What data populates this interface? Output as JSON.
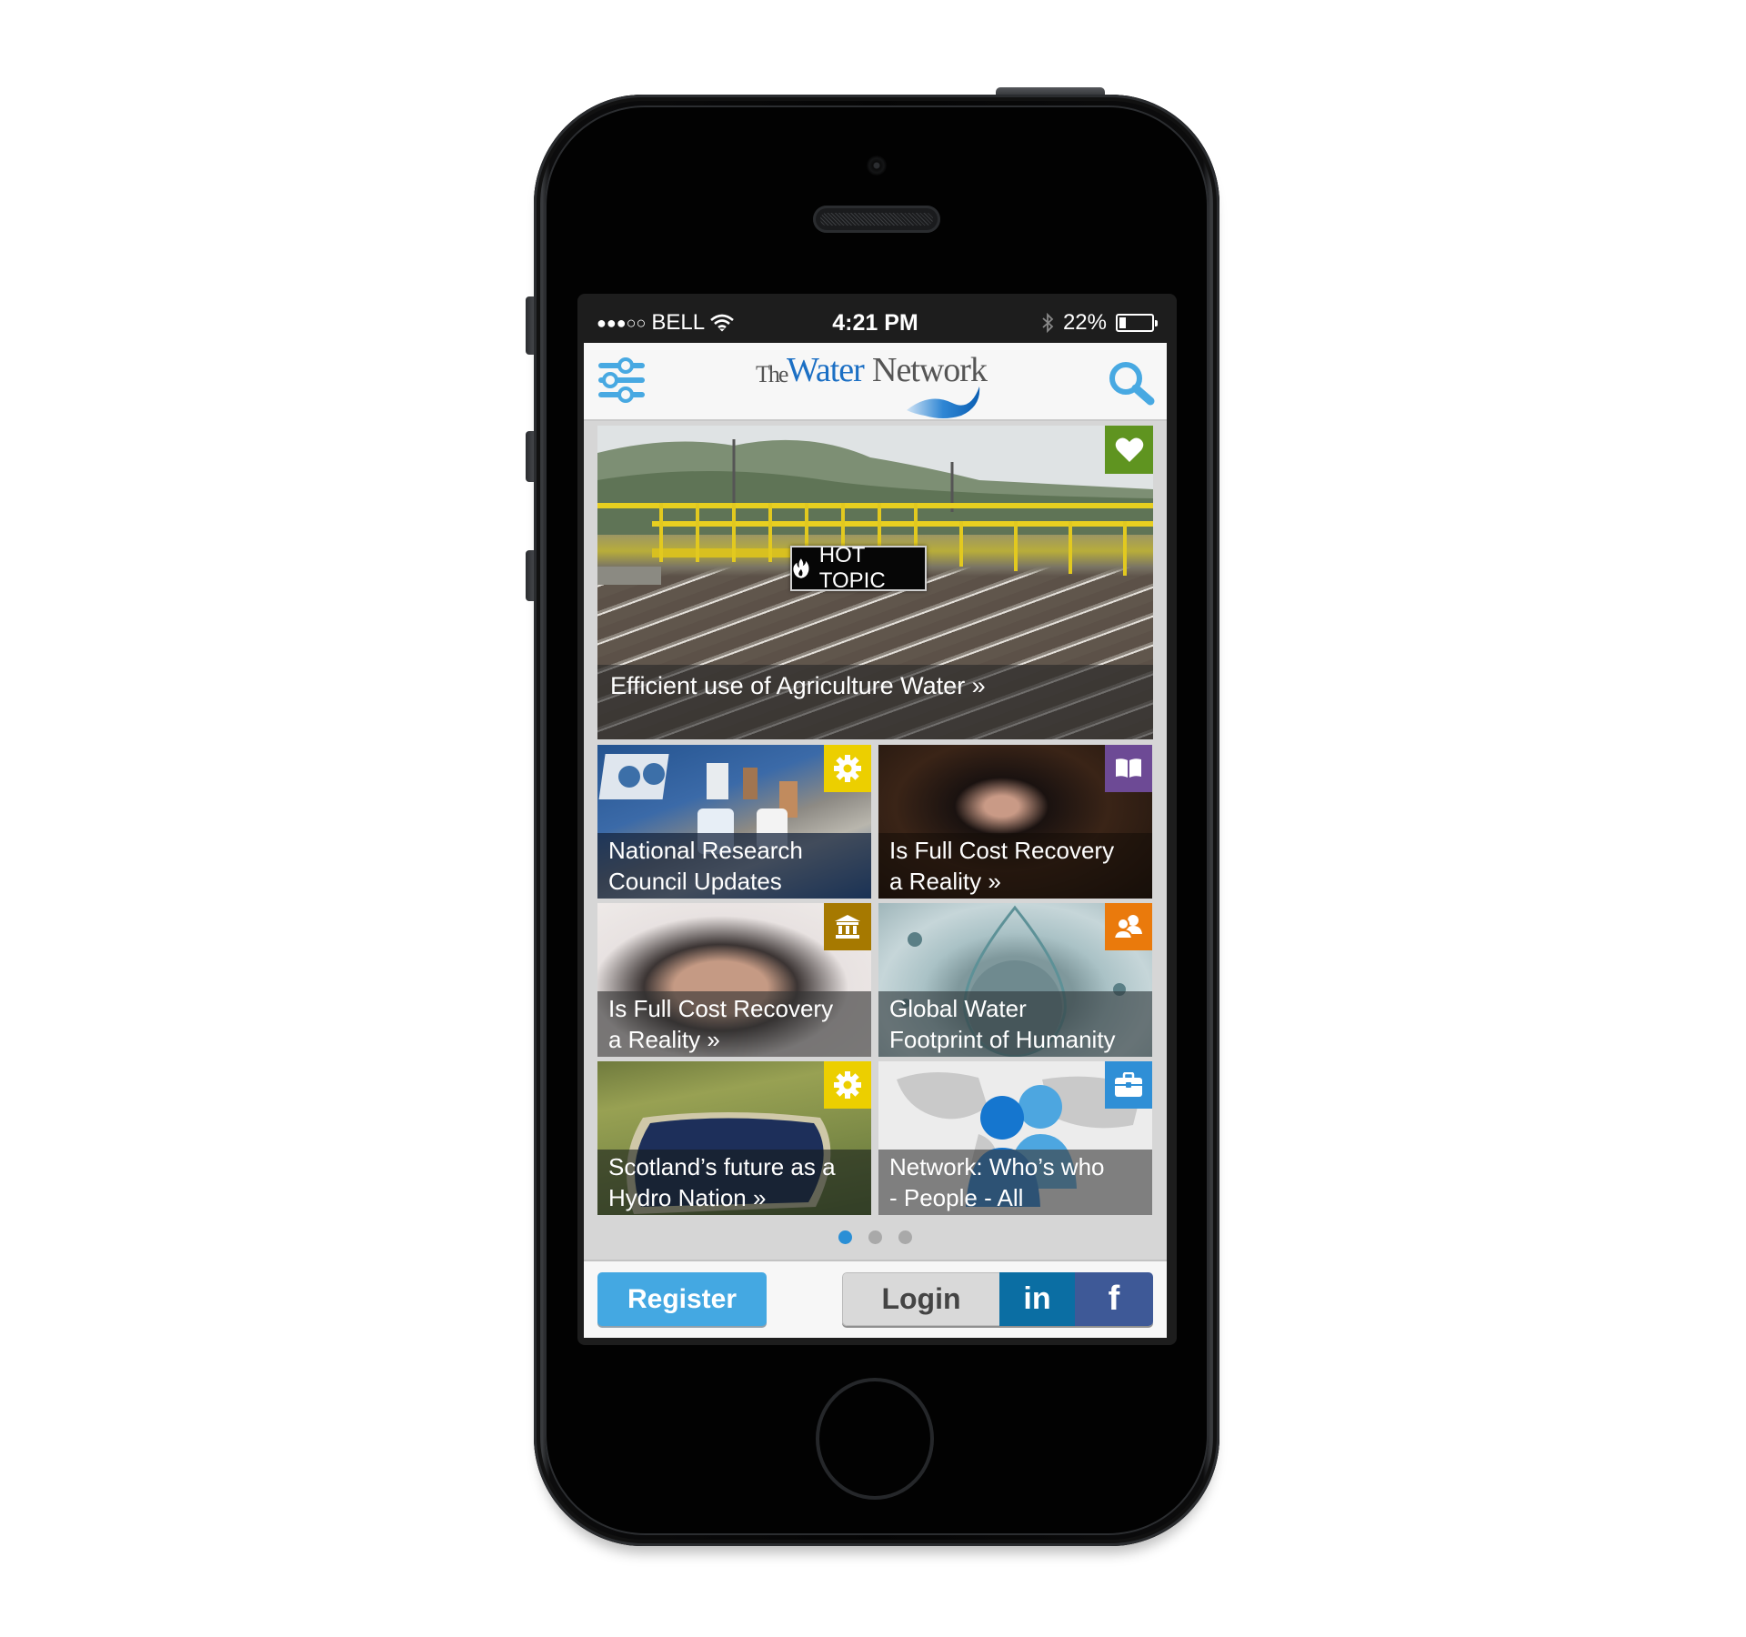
{
  "status_bar": {
    "signal_dots": "●●●○○",
    "carrier": "BELL",
    "time": "4:21 PM",
    "battery_percent_label": "22%",
    "battery_level": 0.22
  },
  "header": {
    "logo_the": "The",
    "logo_water": "Water",
    "logo_network": "Network",
    "menu_icon": "sliders-icon",
    "search_icon": "search-icon"
  },
  "hero": {
    "badge_label": "HOT TOPIC",
    "badge_icon": "flame-icon",
    "caption": "Efficient use of Agriculture Water »",
    "category_icon": "heart-icon",
    "category_color": "#5f9420"
  },
  "tiles": [
    {
      "line1": "National Research",
      "line2": "Council Updates",
      "category_icon": "gear-icon",
      "category_color": "#eccf00"
    },
    {
      "line1": "Is Full Cost Recovery",
      "line2": "a Reality »",
      "category_icon": "book-icon",
      "category_color": "#6d4a95"
    },
    {
      "line1": "Is Full Cost Recovery",
      "line2": "a Reality »",
      "category_icon": "institution-icon",
      "category_color": "#a67900"
    },
    {
      "line1": "Global Water",
      "line2": "Footprint of Humanity",
      "category_icon": "users-icon",
      "category_color": "#ea7a0c"
    },
    {
      "line1": "Scotland’s future as a",
      "line2": "Hydro Nation »",
      "category_icon": "gear-icon",
      "category_color": "#eccf00"
    },
    {
      "line1": "Network: Who’s who",
      "line2": "- People - All",
      "category_icon": "briefcase-icon",
      "category_color": "#2f8fd6"
    }
  ],
  "pager": {
    "pages": 3,
    "active": 1
  },
  "footer": {
    "register_label": "Register",
    "login_label": "Login",
    "linkedin_label": "in",
    "facebook_label": "f"
  },
  "colors": {
    "accent": "#44a8e2",
    "linkedin": "#0b6ea3",
    "facebook": "#3e5997",
    "pager_active": "#2a8fd6"
  }
}
